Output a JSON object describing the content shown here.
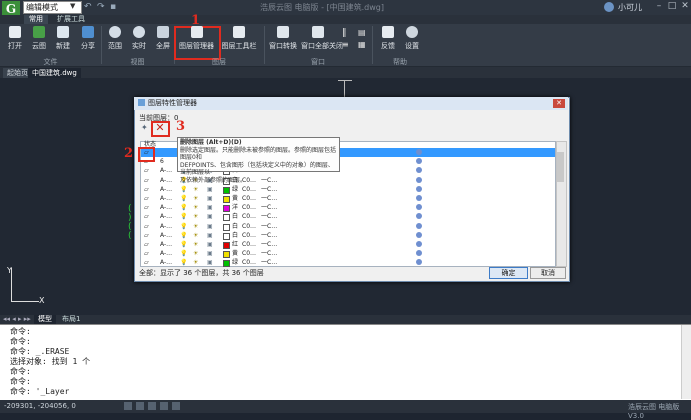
{
  "titlebar": {
    "logo": "G",
    "mode": "编辑模式",
    "title": "浩辰云图 电脑版 - [中国建筑.dwg]",
    "user": "小可儿"
  },
  "ribbon": {
    "tabs": [
      "常用",
      "扩展工具"
    ],
    "buttons": [
      {
        "label": "打开",
        "icon": "open-folder-icon"
      },
      {
        "label": "云图",
        "icon": "cloud-icon"
      },
      {
        "label": "新建",
        "icon": "new-file-icon"
      },
      {
        "label": "分享",
        "icon": "share-icon"
      },
      {
        "label": "范围",
        "icon": "zoom-extent-icon"
      },
      {
        "label": "实时",
        "icon": "zoom-realtime-icon"
      },
      {
        "label": "全屏",
        "icon": "fullscreen-icon"
      },
      {
        "label": "图层管理器",
        "icon": "layer-manager-icon"
      },
      {
        "label": "图层工具栏",
        "icon": "layer-toolbar-icon"
      },
      {
        "label": "窗口转换",
        "icon": "window-switch-icon"
      },
      {
        "label": "窗口全部关闭",
        "icon": "close-all-windows-icon"
      },
      {
        "label": "反馈",
        "icon": "feedback-icon"
      },
      {
        "label": "设置",
        "icon": "settings-icon"
      }
    ],
    "groups": [
      "文件",
      "视图",
      "图层",
      "窗口",
      "帮助"
    ]
  },
  "annotations": [
    "1",
    "2",
    "3"
  ],
  "doctabs": {
    "start": "起始页",
    "file": "中国建筑.dwg"
  },
  "layouttabs": [
    "模型",
    "布局1"
  ],
  "ucs": {
    "x": "X",
    "y": "Y"
  },
  "dialog": {
    "title": "图层特性管理器",
    "current_layer": "当前图层：0",
    "header_state": "状态",
    "tooltip": [
      "删除图层 (Alt+D)(D)",
      "删除选定图层。只能删除未被参照的图层。参照的图层包括图层0和",
      "DEFPOINTS、包含图形（包括块定义中的对象）的图层、当前图层以",
      "及依赖外部参照的图层。"
    ],
    "rows": [
      {
        "name": "",
        "color": "",
        "ltype": ""
      },
      {
        "name": "6",
        "color": "白",
        "ltype": "一数"
      },
      {
        "name": "A-…",
        "color": "白",
        "ltype": "一C…"
      },
      {
        "name": "A-…",
        "color": "白",
        "ltype": "一C…"
      },
      {
        "name": "A-…",
        "color": "绿",
        "ltype": "一C…"
      },
      {
        "name": "A-…",
        "color": "黄",
        "ltype": "一C…"
      },
      {
        "name": "A-…",
        "color": "洋",
        "ltype": "一C…"
      },
      {
        "name": "A-…",
        "color": "白",
        "ltype": "一C…"
      },
      {
        "name": "A-…",
        "color": "白",
        "ltype": "一C…"
      },
      {
        "name": "A-…",
        "color": "白",
        "ltype": "一C…"
      },
      {
        "name": "A-…",
        "color": "红",
        "ltype": "一C…"
      },
      {
        "name": "A-…",
        "color": "黄",
        "ltype": "一C…"
      },
      {
        "name": "A-…",
        "color": "绿",
        "ltype": "一C…"
      }
    ],
    "swatch_colors": [
      "#ffffff",
      "#ffffff",
      "#ffffff",
      "#ffffff",
      "#00c000",
      "#f0e000",
      "#e000e0",
      "#ffffff",
      "#ffffff",
      "#ffffff",
      "#e00000",
      "#f0e000",
      "#00c000"
    ],
    "col_tokens": [
      "C0…"
    ],
    "summary": "全部：显示了 36 个图层，共 36 个图层",
    "ok": "确定",
    "cancel": "取消"
  },
  "command": {
    "lines": [
      "命令:",
      "命令:",
      "命令: _.ERASE",
      "选择对象: 找到 1 个",
      "命令:",
      "命令:",
      "命令: '_Layer"
    ]
  },
  "status": {
    "coords": "-209301, -204056, 0",
    "brand": "浩辰云图 电脑版 V3.0"
  }
}
